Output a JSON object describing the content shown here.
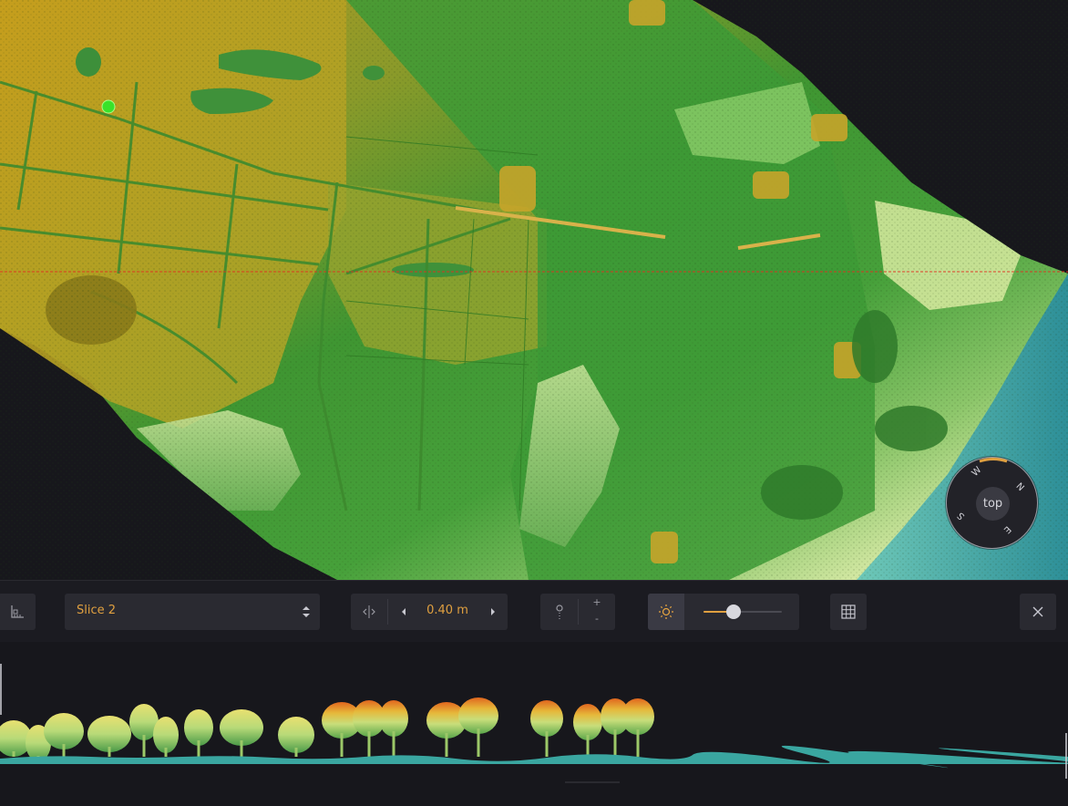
{
  "viewport": {
    "compass": {
      "center_label": "top",
      "north": "N",
      "east": "E",
      "south": "S",
      "west": "W"
    }
  },
  "toolbar": {
    "slice_label": "Slice 2",
    "width_value": "0.40 m",
    "point_size_plus": "+",
    "point_size_minus": "-",
    "lighting_level": 0.38
  },
  "icons": {
    "measure": "ruler-icon",
    "select_arrows": "updown-arrows-icon",
    "width": "expand-width-icon",
    "decrease": "chevron-left-icon",
    "increase": "chevron-right-icon",
    "point": "point-size-icon",
    "sun": "sun-icon",
    "grid": "grid-icon",
    "close": "close-icon"
  },
  "colors": {
    "accent": "#e0a040",
    "background": "#17171c",
    "toolbar": "#1b1b21",
    "button": "#2a2a31"
  }
}
